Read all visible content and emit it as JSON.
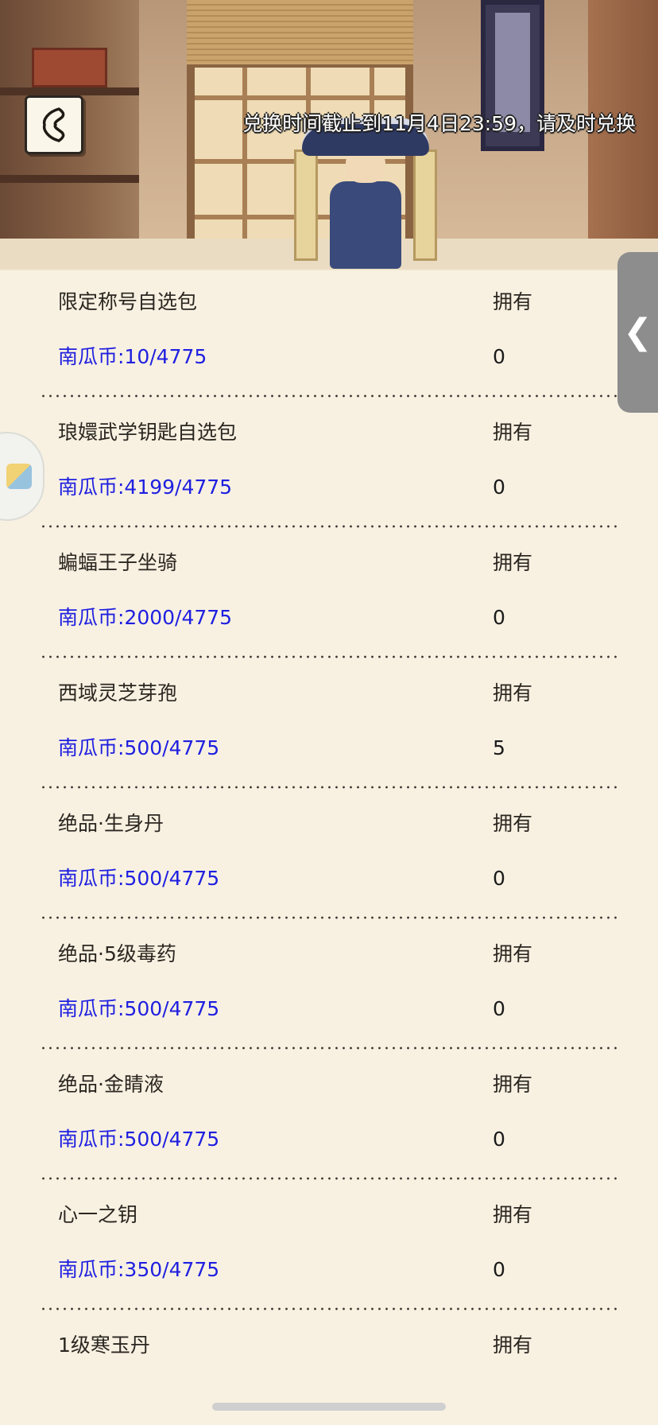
{
  "header": {
    "deadline_notice": "兑换时间截止到11月4日23:59，请及时兑换",
    "back_icon": "back-arrow-icon"
  },
  "side_handle": {
    "glyph": "❮"
  },
  "items": [
    {
      "name": "限定称号自选包",
      "owned_label": "拥有",
      "price": "南瓜币:10/4775",
      "owned": "0"
    },
    {
      "name": "琅嬛武学钥匙自选包",
      "owned_label": "拥有",
      "price": "南瓜币:4199/4775",
      "owned": "0"
    },
    {
      "name": "蝙蝠王子坐骑",
      "owned_label": "拥有",
      "price": "南瓜币:2000/4775",
      "owned": "0"
    },
    {
      "name": "西域灵芝芽孢",
      "owned_label": "拥有",
      "price": "南瓜币:500/4775",
      "owned": "5"
    },
    {
      "name": "绝品·生身丹",
      "owned_label": "拥有",
      "price": "南瓜币:500/4775",
      "owned": "0"
    },
    {
      "name": "绝品·5级毒药",
      "owned_label": "拥有",
      "price": "南瓜币:500/4775",
      "owned": "0"
    },
    {
      "name": "绝品·金睛液",
      "owned_label": "拥有",
      "price": "南瓜币:500/4775",
      "owned": "0"
    },
    {
      "name": "心一之钥",
      "owned_label": "拥有",
      "price": "南瓜币:350/4775",
      "owned": "0"
    },
    {
      "name": "1级寒玉丹",
      "owned_label": "拥有",
      "price": "",
      "owned": ""
    }
  ],
  "colors": {
    "price_text": "#1f1fe0",
    "panel_background": "#f8f1e2"
  }
}
